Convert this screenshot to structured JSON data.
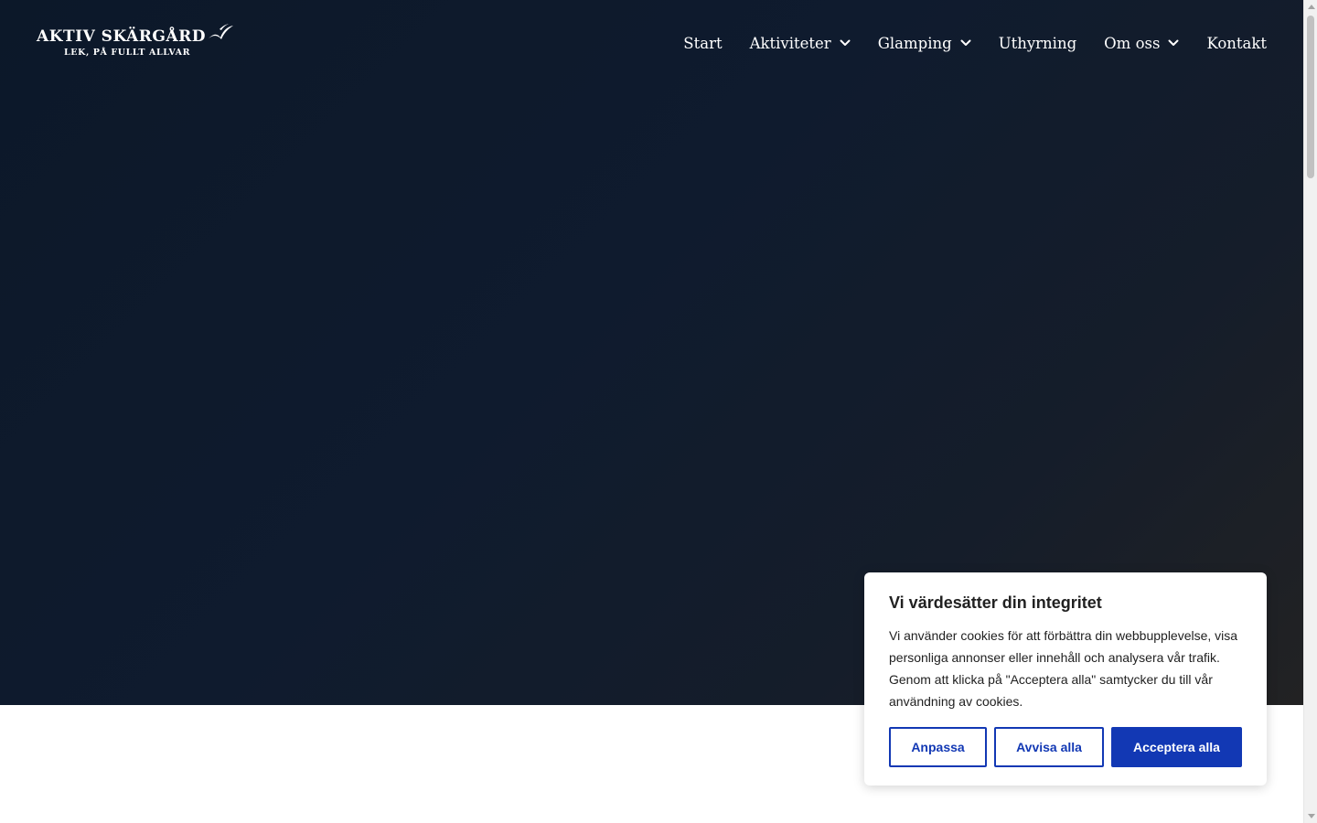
{
  "logo": {
    "main_text": "AKTIV SKÄRGÅRD",
    "tagline": "LEK, PÅ FULLT ALLVAR",
    "icon": "seagull-icon"
  },
  "nav": {
    "items": [
      {
        "label": "Start",
        "has_dropdown": false
      },
      {
        "label": "Aktiviteter",
        "has_dropdown": true
      },
      {
        "label": "Glamping",
        "has_dropdown": true
      },
      {
        "label": "Uthyrning",
        "has_dropdown": false
      },
      {
        "label": "Om oss",
        "has_dropdown": true
      },
      {
        "label": "Kontakt",
        "has_dropdown": false
      }
    ],
    "dropdown_icon": "chevron-down-icon"
  },
  "cookie_banner": {
    "title": "Vi värdesätter din integritet",
    "text": "Vi använder cookies för att förbättra din webbupplevelse, visa personliga annonser eller innehåll och analysera vår trafik. Genom att klicka på \"Acceptera alla\" samtycker du till vår användning av cookies.",
    "customize_label": "Anpassa",
    "reject_label": "Avvisa alla",
    "accept_label": "Acceptera alla"
  },
  "colors": {
    "hero_start": "#0c1829",
    "hero_end": "#222223",
    "accent_blue": "#1238b4",
    "text_dark": "#212121",
    "nav_text": "#ffffff"
  }
}
